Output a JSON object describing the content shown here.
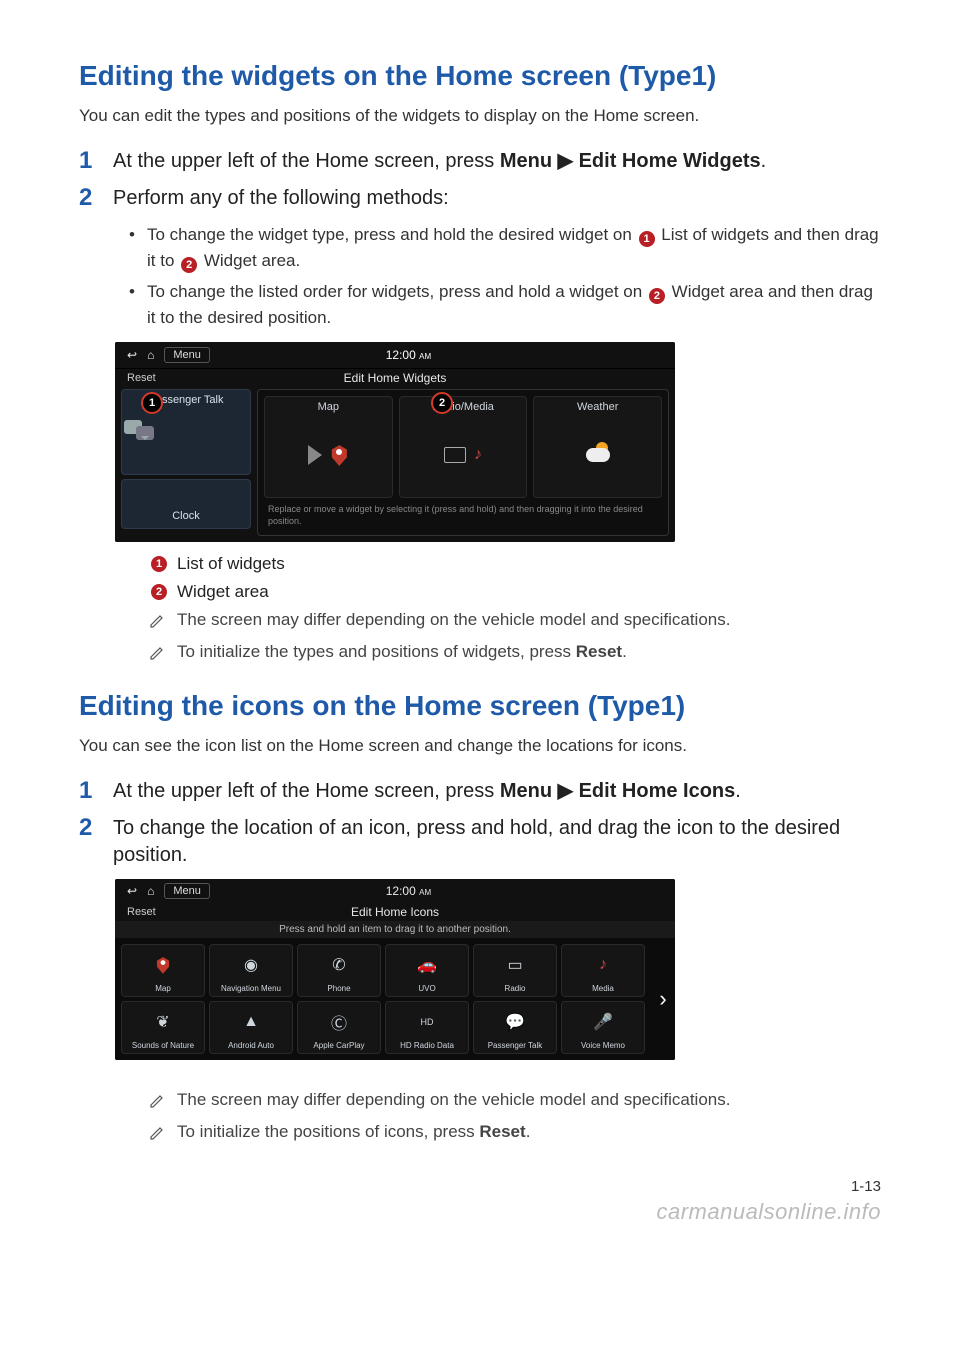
{
  "section1": {
    "heading": "Editing the widgets on the Home screen (Type1)",
    "intro": "You can edit the types and positions of the widgets to display on the Home screen.",
    "step1_pre": "At the upper left of the Home screen, press ",
    "step1_bold": "Menu ▶ Edit Home Widgets",
    "step1_post": ".",
    "step2": "Perform any of the following methods:",
    "bullet1_pre": "To change the widget type, press and hold the desired widget on ",
    "bullet1_mid": " List of widgets and then drag it to ",
    "bullet1_post": " Widget area.",
    "bullet2_pre": "To change the listed order for widgets, press and hold a widget on ",
    "bullet2_post": " Widget area and then drag it to the desired position.",
    "legend1": "List of widgets",
    "legend2": "Widget area",
    "note1": "The screen may differ depending on the vehicle model and specifications.",
    "note2_pre": "To initialize the types and positions of widgets, press ",
    "note2_bold": "Reset",
    "note2_post": "."
  },
  "shot1": {
    "menu": "Menu",
    "clock": "12:00",
    "ampm": "AM",
    "title": "Edit Home Widgets",
    "reset": "Reset",
    "left_tile_top": "Passenger Talk",
    "left_tile_bottom": "Clock",
    "widgets": [
      "Map",
      "Radio/Media",
      "Weather"
    ],
    "help": "Replace or move a widget by selecting it (press and hold) and then dragging it into the desired position.",
    "callouts": [
      "1",
      "2"
    ]
  },
  "section2": {
    "heading": "Editing the icons on the Home screen (Type1)",
    "intro": "You can see the icon list on the Home screen and change the locations for icons.",
    "step1_pre": "At the upper left of the Home screen, press ",
    "step1_bold": "Menu ▶ Edit Home Icons",
    "step1_post": ".",
    "step2": "To change the location of an icon, press and hold, and drag the icon to the desired position.",
    "note1": "The screen may differ depending on the vehicle model and specifications.",
    "note2_pre": "To initialize the positions of icons, press ",
    "note2_bold": "Reset",
    "note2_post": "."
  },
  "shot2": {
    "menu": "Menu",
    "clock": "12:00",
    "ampm": "AM",
    "title": "Edit Home Icons",
    "reset": "Reset",
    "help": "Press and hold an item to drag it to another position.",
    "icons": [
      "Map",
      "Navigation Menu",
      "Phone",
      "UVO",
      "Radio",
      "Media",
      "Sounds of Nature",
      "Android Auto",
      "Apple CarPlay",
      "HD Radio Data",
      "Passenger Talk",
      "Voice Memo"
    ]
  },
  "footer": {
    "page_number": "1-13",
    "watermark": "carmanualsonline.info"
  }
}
